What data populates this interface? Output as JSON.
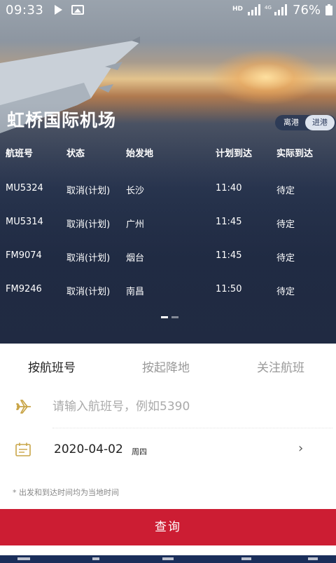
{
  "status_bar": {
    "time": "09:33",
    "hd": "HD",
    "battery": "76%"
  },
  "hero": {
    "airport": "虹桥国际机场",
    "toggle": {
      "departure": "离港",
      "arrival": "进港",
      "selected": "arrival"
    },
    "columns": [
      "航班号",
      "状态",
      "始发地",
      "计划到达",
      "实际到达"
    ],
    "flights": [
      {
        "flight": "MU5324",
        "status": "取消(计划)",
        "origin": "长沙",
        "scheduled": "11:40",
        "actual": "待定"
      },
      {
        "flight": "MU5314",
        "status": "取消(计划)",
        "origin": "广州",
        "scheduled": "11:45",
        "actual": "待定"
      },
      {
        "flight": "FM9074",
        "status": "取消(计划)",
        "origin": "烟台",
        "scheduled": "11:45",
        "actual": "待定"
      },
      {
        "flight": "FM9246",
        "status": "取消(计划)",
        "origin": "南昌",
        "scheduled": "11:50",
        "actual": "待定"
      }
    ]
  },
  "search": {
    "tabs": [
      "按航班号",
      "按起降地",
      "关注航班"
    ],
    "active_tab": 0,
    "flight_input": {
      "value": "",
      "placeholder": "请输入航班号，例如5390"
    },
    "date": "2020-04-02",
    "weekday": "周四",
    "note": "* 出发和到达时间均为当地时间",
    "query_label": "查询"
  },
  "colors": {
    "accent": "#cc1d33",
    "icon": "#c9a548"
  }
}
